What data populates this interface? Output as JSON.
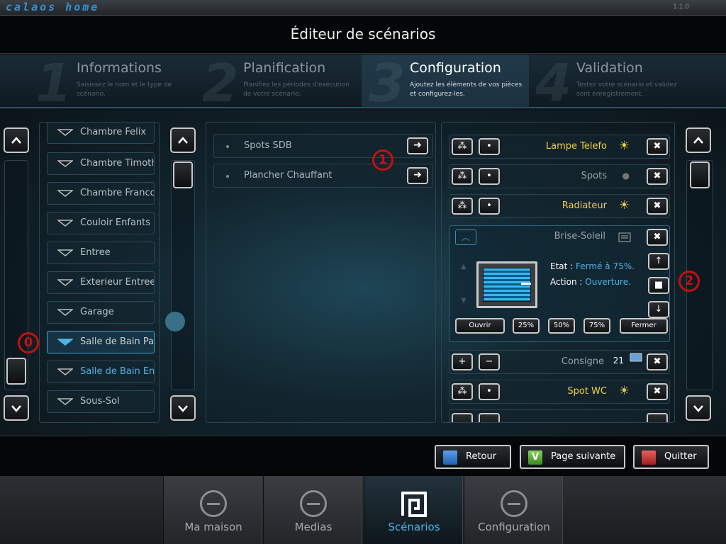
{
  "brand": "calaos home",
  "version": "1.1.0",
  "title": "Éditeur de scénarios",
  "steps": [
    {
      "num": "1",
      "title": "Informations",
      "desc": "Saisissez le nom et le type de scénario."
    },
    {
      "num": "2",
      "title": "Planification",
      "desc": "Planifiez les périodes d'exécution de votre scénario."
    },
    {
      "num": "3",
      "title": "Configuration",
      "desc": "Ajoutez les éléments de vos pièces et configurez-les."
    },
    {
      "num": "4",
      "title": "Validation",
      "desc": "Testez votre scénario et validez sont enregistrement."
    }
  ],
  "rooms": [
    "Chambre Felix",
    "Chambre Timothe",
    "Chambre Francois",
    "Couloir Enfants",
    "Entree",
    "Exterieur Entree",
    "Garage",
    "Salle de Bain Pare",
    "Salle de Bain Enfa",
    "Sous-Sol"
  ],
  "items": [
    "Spots SDB",
    "Plancher Chauffant"
  ],
  "actions": {
    "lampe": "Lampe Telefo",
    "spots": "Spots",
    "radiateur": "Radiateur",
    "consigne": "Consigne",
    "consigne_value": "21",
    "spotwc": "Spot WC"
  },
  "blind": {
    "name": "Brise-Soleil",
    "etat_label": "Etat :",
    "etat_value": "Fermé à 75%.",
    "action_label": "Action :",
    "action_value": "Ouverture.",
    "buttons": {
      "open": "Ouvrir",
      "p25": "25%",
      "p50": "50%",
      "p75": "75%",
      "close": "Fermer"
    }
  },
  "badges": {
    "b0": "0",
    "b1": "1",
    "b2": "2"
  },
  "nav": {
    "back": "Retour",
    "next": "Page suivante",
    "quit": "Quitter"
  },
  "tabs": [
    "Ma maison",
    "Medias",
    "Scénarios",
    "Configuration"
  ],
  "colors": {
    "accent": "#4fb4ea",
    "active_label": "#f0d040",
    "badge": "#c41010"
  }
}
